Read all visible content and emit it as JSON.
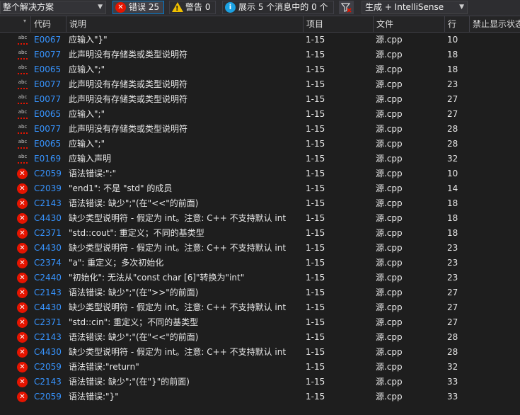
{
  "toolbar": {
    "scope": "整个解决方案",
    "errors_label": "错误 25",
    "warnings_label": "警告 0",
    "messages_label": "展示 5 个消息中的 0 个",
    "build_filter": "生成 + IntelliSense"
  },
  "columns": {
    "code": "代码",
    "description": "说明",
    "project": "项目",
    "file": "文件",
    "line": "行",
    "suppression": "禁止显示状态"
  },
  "rows": [
    {
      "type": "intellisense",
      "code": "E0067",
      "desc": "应输入\"}\"",
      "project": "1-15",
      "file": "源.cpp",
      "line": "10"
    },
    {
      "type": "intellisense",
      "code": "E0077",
      "desc": "此声明没有存储类或类型说明符",
      "project": "1-15",
      "file": "源.cpp",
      "line": "18"
    },
    {
      "type": "intellisense",
      "code": "E0065",
      "desc": "应输入\";\"",
      "project": "1-15",
      "file": "源.cpp",
      "line": "18"
    },
    {
      "type": "intellisense",
      "code": "E0077",
      "desc": "此声明没有存储类或类型说明符",
      "project": "1-15",
      "file": "源.cpp",
      "line": "23"
    },
    {
      "type": "intellisense",
      "code": "E0077",
      "desc": "此声明没有存储类或类型说明符",
      "project": "1-15",
      "file": "源.cpp",
      "line": "27"
    },
    {
      "type": "intellisense",
      "code": "E0065",
      "desc": "应输入\";\"",
      "project": "1-15",
      "file": "源.cpp",
      "line": "27"
    },
    {
      "type": "intellisense",
      "code": "E0077",
      "desc": "此声明没有存储类或类型说明符",
      "project": "1-15",
      "file": "源.cpp",
      "line": "28"
    },
    {
      "type": "intellisense",
      "code": "E0065",
      "desc": "应输入\";\"",
      "project": "1-15",
      "file": "源.cpp",
      "line": "28"
    },
    {
      "type": "intellisense",
      "code": "E0169",
      "desc": "应输入声明",
      "project": "1-15",
      "file": "源.cpp",
      "line": "32"
    },
    {
      "type": "error",
      "code": "C2059",
      "desc": "语法错误:\":\"",
      "project": "1-15",
      "file": "源.cpp",
      "line": "10"
    },
    {
      "type": "error",
      "code": "C2039",
      "desc": "\"end1\": 不是 \"std\" 的成员",
      "project": "1-15",
      "file": "源.cpp",
      "line": "14"
    },
    {
      "type": "error",
      "code": "C2143",
      "desc": "语法错误: 缺少\";\"(在\"<<\"的前面)",
      "project": "1-15",
      "file": "源.cpp",
      "line": "18"
    },
    {
      "type": "error",
      "code": "C4430",
      "desc": "缺少类型说明符 - 假定为 int。注意: C++ 不支持默认 int",
      "project": "1-15",
      "file": "源.cpp",
      "line": "18"
    },
    {
      "type": "error",
      "code": "C2371",
      "desc": "\"std::cout\": 重定义；不同的基类型",
      "project": "1-15",
      "file": "源.cpp",
      "line": "18"
    },
    {
      "type": "error",
      "code": "C4430",
      "desc": "缺少类型说明符 - 假定为 int。注意: C++ 不支持默认 int",
      "project": "1-15",
      "file": "源.cpp",
      "line": "23"
    },
    {
      "type": "error",
      "code": "C2374",
      "desc": "\"a\": 重定义；多次初始化",
      "project": "1-15",
      "file": "源.cpp",
      "line": "23"
    },
    {
      "type": "error",
      "code": "C2440",
      "desc": "\"初始化\": 无法从\"const char [6]\"转换为\"int\"",
      "project": "1-15",
      "file": "源.cpp",
      "line": "23"
    },
    {
      "type": "error",
      "code": "C2143",
      "desc": "语法错误: 缺少\";\"(在\">>\"的前面)",
      "project": "1-15",
      "file": "源.cpp",
      "line": "27"
    },
    {
      "type": "error",
      "code": "C4430",
      "desc": "缺少类型说明符 - 假定为 int。注意: C++ 不支持默认 int",
      "project": "1-15",
      "file": "源.cpp",
      "line": "27"
    },
    {
      "type": "error",
      "code": "C2371",
      "desc": "\"std::cin\": 重定义；不同的基类型",
      "project": "1-15",
      "file": "源.cpp",
      "line": "27"
    },
    {
      "type": "error",
      "code": "C2143",
      "desc": "语法错误: 缺少\";\"(在\"<<\"的前面)",
      "project": "1-15",
      "file": "源.cpp",
      "line": "28"
    },
    {
      "type": "error",
      "code": "C4430",
      "desc": "缺少类型说明符 - 假定为 int。注意: C++ 不支持默认 int",
      "project": "1-15",
      "file": "源.cpp",
      "line": "28"
    },
    {
      "type": "error",
      "code": "C2059",
      "desc": "语法错误:\"return\"",
      "project": "1-15",
      "file": "源.cpp",
      "line": "32"
    },
    {
      "type": "error",
      "code": "C2143",
      "desc": "语法错误: 缺少\";\"(在\"}\"的前面)",
      "project": "1-15",
      "file": "源.cpp",
      "line": "33"
    },
    {
      "type": "error",
      "code": "C2059",
      "desc": "语法错误:\"}\"",
      "project": "1-15",
      "file": "源.cpp",
      "line": "33"
    }
  ],
  "icons": {
    "error": "error-circle-icon",
    "intellisense": "abc-spelling-icon",
    "warning": "warning-triangle-icon",
    "info": "info-circle-icon",
    "filter": "filter-funnel-icon"
  },
  "colors": {
    "background": "#1e1e1e",
    "code_link": "#3794ff",
    "error": "#e51400",
    "warning": "#f0c000",
    "info": "#1ba1e2",
    "accent": "#007acc"
  }
}
